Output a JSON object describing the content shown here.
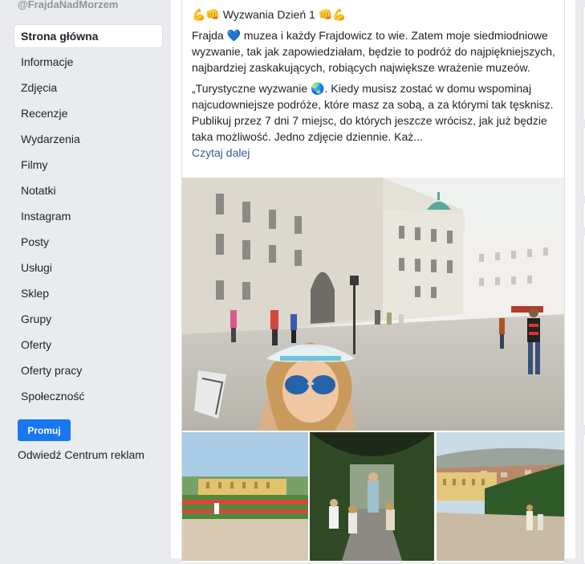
{
  "sidebar": {
    "handle": "@FrajdaNadMorzem",
    "items": [
      {
        "label": "Strona główna",
        "active": true
      },
      {
        "label": "Informacje"
      },
      {
        "label": "Zdjęcia"
      },
      {
        "label": "Recenzje"
      },
      {
        "label": "Wydarzenia"
      },
      {
        "label": "Filmy"
      },
      {
        "label": "Notatki"
      },
      {
        "label": "Instagram"
      },
      {
        "label": "Posty"
      },
      {
        "label": "Usługi"
      },
      {
        "label": "Sklep"
      },
      {
        "label": "Grupy"
      },
      {
        "label": "Oferty"
      },
      {
        "label": "Oferty pracy"
      },
      {
        "label": "Społeczność"
      }
    ],
    "promote_label": "Promuj",
    "ads_link": "Odwiedź Centrum reklam"
  },
  "post": {
    "title": "Wyzwania Dzień 1",
    "title_emoji_left": "💪👊",
    "title_emoji_right": "👊💪",
    "para1_a": "Frajda ",
    "para1_emoji": "💙",
    "para1_b": " muzea i każdy Frajdowicz to wie. Zatem moje siedmiodniowe wyzwanie, tak jak zapowiedziałam, będzie to podróż do najpiękniejszych, najbardziej zaskakujących, robiących największe wrażenie muzeów.",
    "para2_a": "„Turystyczne wyzwanie ",
    "para2_emoji": "🌏",
    "para2_b": ". Kiedy musisz zostać w domu wspominaj najcudowniejsze podróże, które masz za sobą, a za którymi tak tęsknisz. Publikuj przez 7 dni 7 miejsc, do których jeszcze wrócisz, jak już będzie taka możliwość. Jedno zdjęcie dziennie. Każ...",
    "read_more": "Czytaj dalej"
  }
}
